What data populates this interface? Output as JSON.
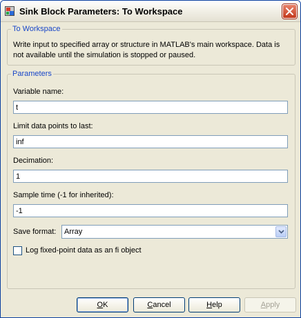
{
  "window": {
    "title": "Sink Block Parameters: To Workspace"
  },
  "description_group": {
    "legend": "To Workspace",
    "text": "Write input to specified array or structure in MATLAB's main workspace. Data is not available until the simulation is stopped or paused."
  },
  "parameters": {
    "legend": "Parameters",
    "variable_name": {
      "label": "Variable name:",
      "value": "t"
    },
    "limit_points": {
      "label": "Limit data points to last:",
      "value": "inf"
    },
    "decimation": {
      "label": "Decimation:",
      "value": "1"
    },
    "sample_time": {
      "label": "Sample time (-1 for inherited):",
      "value": "-1"
    },
    "save_format": {
      "label": "Save format:",
      "value": "Array"
    },
    "log_fixed_point": {
      "label": "Log fixed-point data as an fi object",
      "checked": false
    }
  },
  "buttons": {
    "ok": {
      "prefix": "",
      "mnemonic": "O",
      "rest": "K"
    },
    "cancel": {
      "prefix": "",
      "mnemonic": "C",
      "rest": "ancel"
    },
    "help": {
      "prefix": "",
      "mnemonic": "H",
      "rest": "elp"
    },
    "apply": {
      "prefix": "",
      "mnemonic": "A",
      "rest": "pply"
    }
  },
  "icons": {
    "app": "simulink-block-icon",
    "close": "close-icon",
    "dropdown": "chevron-down-icon"
  },
  "colors": {
    "accent": "#1846c8",
    "close_button": "#c2391c",
    "panel_bg": "#ece9d8"
  }
}
